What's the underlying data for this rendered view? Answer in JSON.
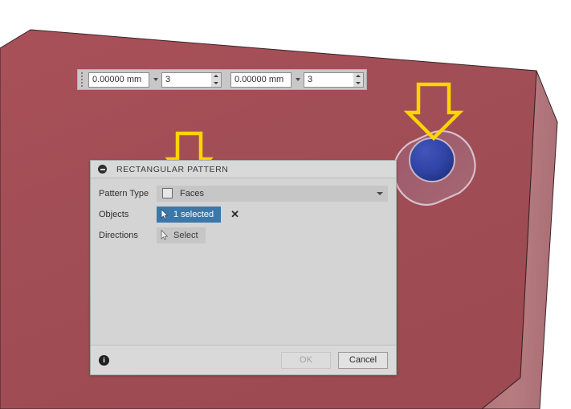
{
  "app": {
    "scene_background": "#ffffff",
    "body_top_face_color": "#a04d55",
    "body_side_face_color": "#b67c80",
    "selected_face_color": "#2a3f9e",
    "highlight_arrow_color": "#ffd400"
  },
  "manipulator_toolbar": {
    "grip_icon": "drag-grip-icon",
    "fields": [
      {
        "name": "distance-1",
        "value": "0.00000 mm",
        "dropdown_icon": "chevron-down-icon"
      },
      {
        "name": "quantity-1",
        "value": "3",
        "spinner_icon": "spinner-arrows-icon"
      },
      {
        "name": "distance-2",
        "value": "0.00000 mm",
        "dropdown_icon": "chevron-down-icon"
      },
      {
        "name": "quantity-2",
        "value": "3",
        "spinner_icon": "spinner-arrows-icon"
      }
    ]
  },
  "dialog": {
    "title": "RECTANGULAR PATTERN",
    "collapse_icon": "collapse-minus-icon",
    "rows": {
      "pattern_type": {
        "label": "Pattern Type",
        "value": "Faces",
        "checkbox_icon": "checkbox-icon",
        "caret_icon": "chevron-down-icon"
      },
      "objects": {
        "label": "Objects",
        "button_text": "1 selected",
        "cursor_icon": "selection-cursor-icon",
        "clear_icon": "close-x-icon",
        "state": "active"
      },
      "directions": {
        "label": "Directions",
        "button_text": "Select",
        "cursor_icon": "selection-cursor-icon",
        "state": "idle"
      }
    },
    "footer": {
      "info_icon": "info-icon",
      "info_glyph": "i",
      "ok_label": "OK",
      "ok_enabled": false,
      "cancel_label": "Cancel",
      "cancel_enabled": true
    }
  },
  "annotations": {
    "arrow_dialog": {
      "name": "highlight-arrow-pattern-type",
      "target": "Faces checkbox"
    },
    "arrow_model": {
      "name": "highlight-arrow-selected-face",
      "target": "selected circular face"
    }
  },
  "model": {
    "name": "rectangular-block-with-slot",
    "selected_face_name": "circular-face-selected",
    "slot_name": "slot-feature"
  }
}
